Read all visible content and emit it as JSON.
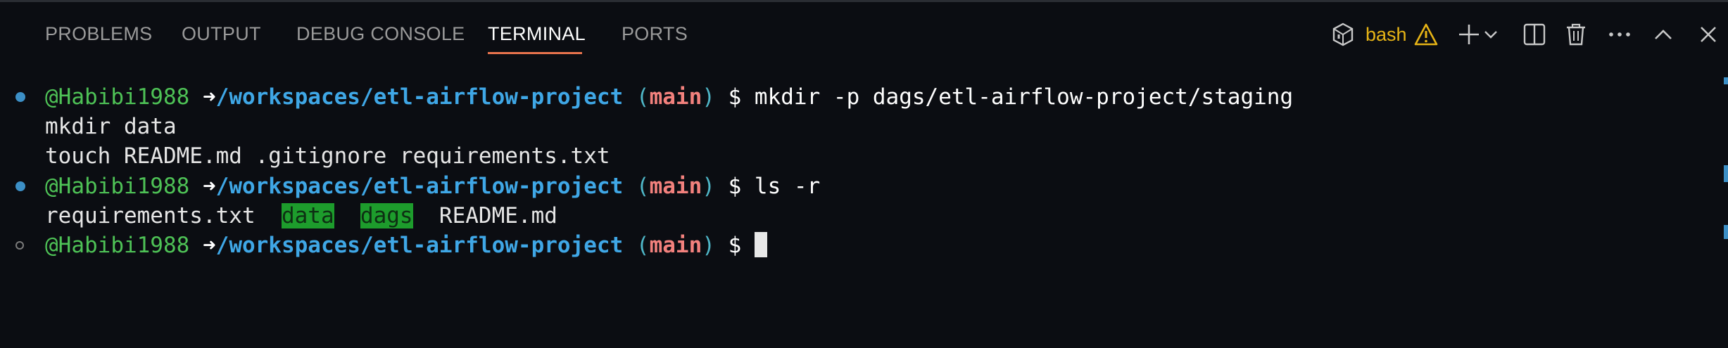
{
  "panel": {
    "tabs": [
      {
        "label": "PROBLEMS",
        "active": false
      },
      {
        "label": "OUTPUT",
        "active": false
      },
      {
        "label": "DEBUG CONSOLE",
        "active": false
      },
      {
        "label": "TERMINAL",
        "active": true
      },
      {
        "label": "PORTS",
        "active": false
      }
    ],
    "active_tab_color": "#e8734d",
    "terminal_profile": "bash",
    "actions": [
      "terminal-shell-icon",
      "warning-icon",
      "plus-icon",
      "chevron-down-icon",
      "split-terminal-icon",
      "trash-icon",
      "more-icon",
      "maximize-chevron-up-icon",
      "close-icon"
    ]
  },
  "terminal": {
    "user": "@Habibi1988",
    "arrow": "➜",
    "path": "/workspaces/etl-airflow-project",
    "branch": "main",
    "lines": [
      {
        "status": "ok",
        "command": "mkdir -p dags/etl-airflow-project/staging"
      },
      {
        "output": "mkdir data"
      },
      {
        "output": "touch README.md .gitignore requirements.txt"
      },
      {
        "status": "ok",
        "command": "ls -r"
      },
      {
        "listing": [
          "requirements.txt",
          "data",
          "dags",
          "README.md"
        ],
        "directories": [
          "data",
          "dags"
        ]
      },
      {
        "status": "pending",
        "command": ""
      }
    ],
    "colors": {
      "user": "#4ec256",
      "path": "#3fa7e6",
      "branch": "#f2817d",
      "dir_highlight": "#1d9c2c",
      "status_ok": "#3c8fc6"
    }
  }
}
